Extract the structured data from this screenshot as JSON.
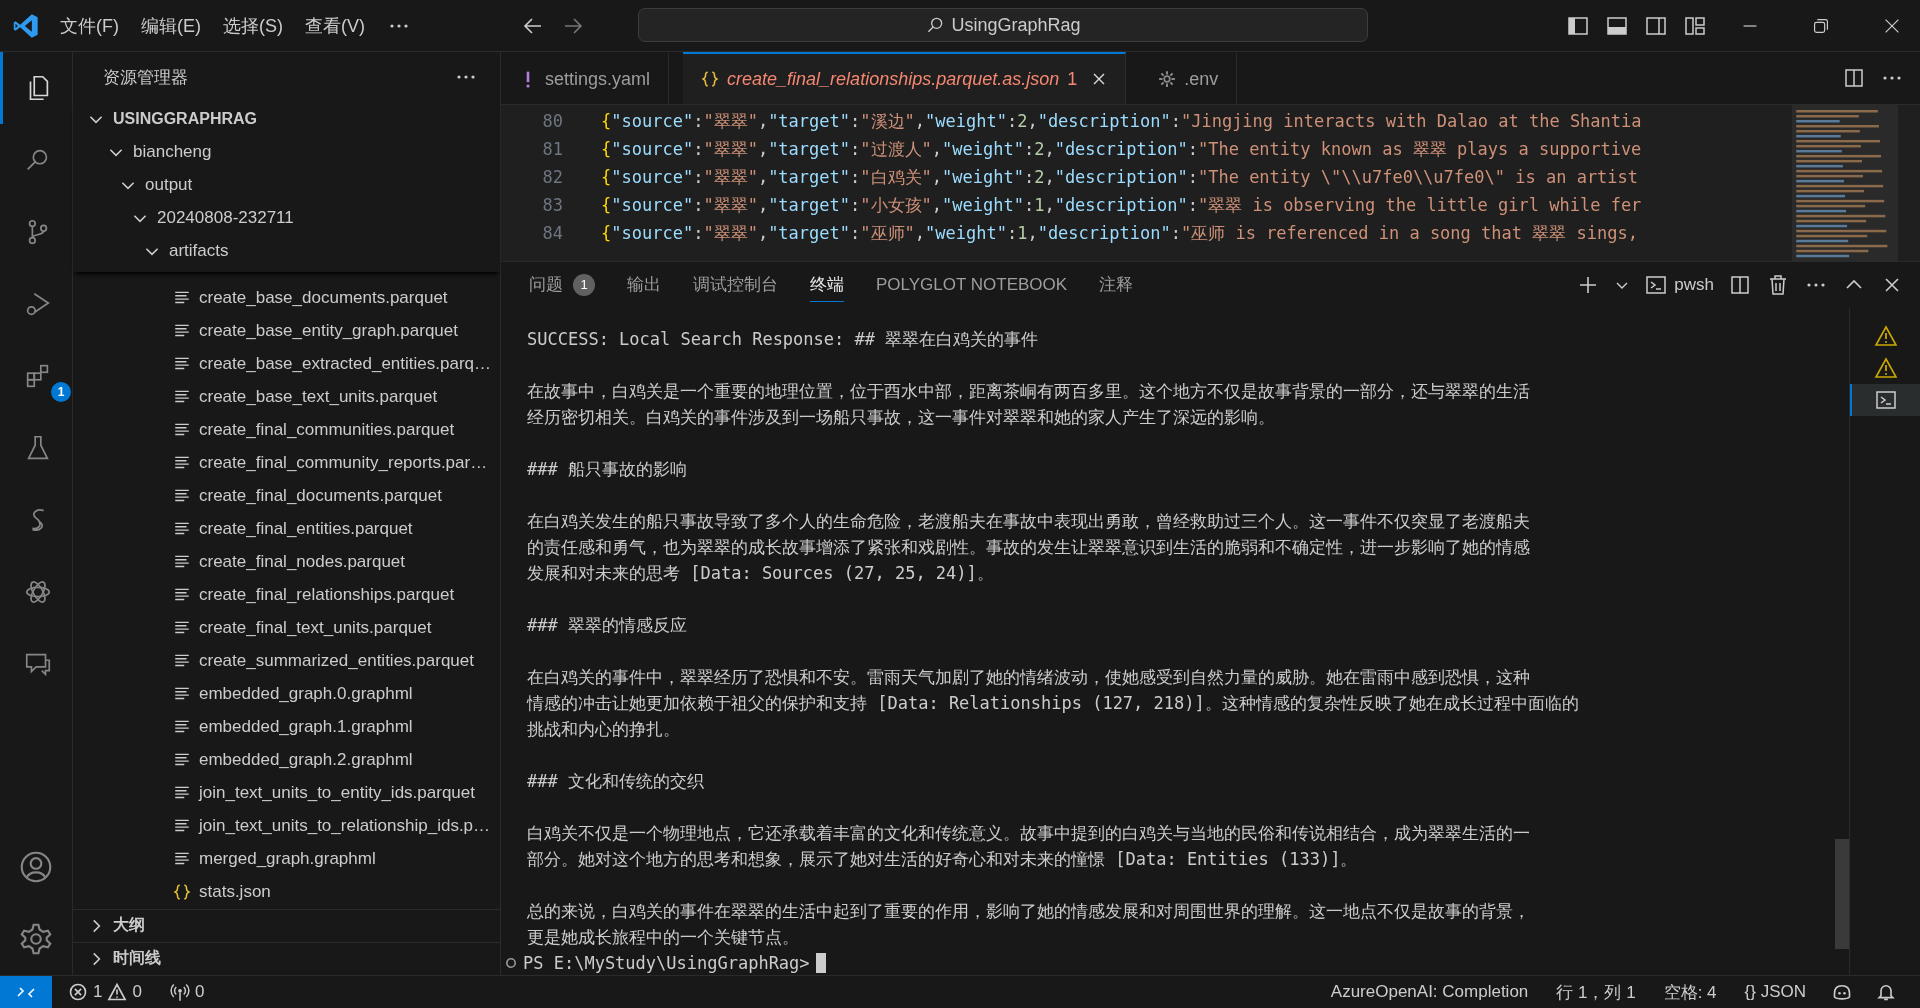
{
  "title_bar": {
    "menus": [
      "文件(F)",
      "编辑(E)",
      "选择(S)",
      "查看(V)"
    ],
    "search": "UsingGraphRag"
  },
  "activity_bar": [
    {
      "kind": "explorer",
      "selected": true
    },
    {
      "kind": "search",
      "selected": false
    },
    {
      "kind": "source-control",
      "selected": false
    },
    {
      "kind": "run-debug",
      "selected": false
    },
    {
      "kind": "extensions",
      "selected": false,
      "badge": "1"
    },
    {
      "kind": "testing",
      "selected": false
    },
    {
      "kind": "swirl",
      "selected": false
    },
    {
      "kind": "atom",
      "selected": false
    },
    {
      "kind": "chat",
      "selected": false
    }
  ],
  "sidebar": {
    "title": "资源管理器",
    "tree": {
      "label": "USINGGRAPHRAG",
      "kind": "folder",
      "expanded": true,
      "children": [
        {
          "label": "biancheng",
          "kind": "folder",
          "expanded": true,
          "children": [
            {
              "label": "output",
              "kind": "folder",
              "expanded": true,
              "children": [
                {
                  "label": "20240808-232711",
                  "kind": "folder",
                  "expanded": true,
                  "children": [
                    {
                      "label": "artifacts",
                      "kind": "folder",
                      "expanded": true,
                      "children": [
                        {
                          "label": "create_base_documents.parquet",
                          "kind": "file"
                        },
                        {
                          "label": "create_base_entity_graph.parquet",
                          "kind": "file"
                        },
                        {
                          "label": "create_base_extracted_entities.parq…",
                          "kind": "file"
                        },
                        {
                          "label": "create_base_text_units.parquet",
                          "kind": "file"
                        },
                        {
                          "label": "create_final_communities.parquet",
                          "kind": "file"
                        },
                        {
                          "label": "create_final_community_reports.par…",
                          "kind": "file"
                        },
                        {
                          "label": "create_final_documents.parquet",
                          "kind": "file"
                        },
                        {
                          "label": "create_final_entities.parquet",
                          "kind": "file"
                        },
                        {
                          "label": "create_final_nodes.parquet",
                          "kind": "file"
                        },
                        {
                          "label": "create_final_relationships.parquet",
                          "kind": "file"
                        },
                        {
                          "label": "create_final_text_units.parquet",
                          "kind": "file"
                        },
                        {
                          "label": "create_summarized_entities.parquet",
                          "kind": "file"
                        },
                        {
                          "label": "embedded_graph.0.graphml",
                          "kind": "file"
                        },
                        {
                          "label": "embedded_graph.1.graphml",
                          "kind": "file"
                        },
                        {
                          "label": "embedded_graph.2.graphml",
                          "kind": "file"
                        },
                        {
                          "label": "join_text_units_to_entity_ids.parquet",
                          "kind": "file"
                        },
                        {
                          "label": "join_text_units_to_relationship_ids.p…",
                          "kind": "file"
                        },
                        {
                          "label": "merged_graph.graphml",
                          "kind": "file"
                        },
                        {
                          "label": "stats.json",
                          "kind": "json"
                        }
                      ]
                    }
                  ]
                }
              ]
            }
          ]
        }
      ]
    },
    "sections": [
      {
        "label": "大纲",
        "expanded": false
      },
      {
        "label": "时间线",
        "expanded": false
      }
    ]
  },
  "editor": {
    "tabs": [
      {
        "kind": "yaml",
        "label": "settings.yaml",
        "selected": false
      },
      {
        "kind": "json",
        "label": "create_final_relationships.parquet.as.json",
        "problems": "1",
        "selected": true
      },
      {
        "kind": "env",
        "label": ".env",
        "selected": false
      }
    ],
    "lines": [
      {
        "number": "80",
        "tokens": [
          {
            "kind": "brace",
            "text": "{"
          },
          {
            "kind": "key",
            "text": "\"source\""
          },
          {
            "kind": "punct",
            "text": ":"
          },
          {
            "kind": "str",
            "text": "\"翠翠\""
          },
          {
            "kind": "punct",
            "text": ","
          },
          {
            "kind": "key",
            "text": "\"target\""
          },
          {
            "kind": "punct",
            "text": ":"
          },
          {
            "kind": "str",
            "text": "\"溪边\""
          },
          {
            "kind": "punct",
            "text": ","
          },
          {
            "kind": "key",
            "text": "\"weight\""
          },
          {
            "kind": "punct",
            "text": ":"
          },
          {
            "kind": "num",
            "text": "2"
          },
          {
            "kind": "punct",
            "text": ","
          },
          {
            "kind": "key",
            "text": "\"description\""
          },
          {
            "kind": "punct",
            "text": ":"
          },
          {
            "kind": "str",
            "text": "\"Jingjing interacts with Dalao at the Shantia"
          }
        ]
      },
      {
        "number": "81",
        "tokens": [
          {
            "kind": "brace",
            "text": "{"
          },
          {
            "kind": "key",
            "text": "\"source\""
          },
          {
            "kind": "punct",
            "text": ":"
          },
          {
            "kind": "str",
            "text": "\"翠翠\""
          },
          {
            "kind": "punct",
            "text": ","
          },
          {
            "kind": "key",
            "text": "\"target\""
          },
          {
            "kind": "punct",
            "text": ":"
          },
          {
            "kind": "str",
            "text": "\"过渡人\""
          },
          {
            "kind": "punct",
            "text": ","
          },
          {
            "kind": "key",
            "text": "\"weight\""
          },
          {
            "kind": "punct",
            "text": ":"
          },
          {
            "kind": "num",
            "text": "2"
          },
          {
            "kind": "punct",
            "text": ","
          },
          {
            "kind": "key",
            "text": "\"description\""
          },
          {
            "kind": "punct",
            "text": ":"
          },
          {
            "kind": "str",
            "text": "\"The entity known as 翠翠 plays a supportive"
          }
        ]
      },
      {
        "number": "82",
        "tokens": [
          {
            "kind": "brace",
            "text": "{"
          },
          {
            "kind": "key",
            "text": "\"source\""
          },
          {
            "kind": "punct",
            "text": ":"
          },
          {
            "kind": "str",
            "text": "\"翠翠\""
          },
          {
            "kind": "punct",
            "text": ","
          },
          {
            "kind": "key",
            "text": "\"target\""
          },
          {
            "kind": "punct",
            "text": ":"
          },
          {
            "kind": "str",
            "text": "\"白鸡关\""
          },
          {
            "kind": "punct",
            "text": ","
          },
          {
            "kind": "key",
            "text": "\"weight\""
          },
          {
            "kind": "punct",
            "text": ":"
          },
          {
            "kind": "num",
            "text": "2"
          },
          {
            "kind": "punct",
            "text": ","
          },
          {
            "kind": "key",
            "text": "\"description\""
          },
          {
            "kind": "punct",
            "text": ":"
          },
          {
            "kind": "str",
            "text": "\"The entity \\\"\\\\u7fe0\\\\u7fe0\\\" is an artist"
          }
        ]
      },
      {
        "number": "83",
        "tokens": [
          {
            "kind": "brace",
            "text": "{"
          },
          {
            "kind": "key",
            "text": "\"source\""
          },
          {
            "kind": "punct",
            "text": ":"
          },
          {
            "kind": "str",
            "text": "\"翠翠\""
          },
          {
            "kind": "punct",
            "text": ","
          },
          {
            "kind": "key",
            "text": "\"target\""
          },
          {
            "kind": "punct",
            "text": ":"
          },
          {
            "kind": "str",
            "text": "\"小女孩\""
          },
          {
            "kind": "punct",
            "text": ","
          },
          {
            "kind": "key",
            "text": "\"weight\""
          },
          {
            "kind": "punct",
            "text": ":"
          },
          {
            "kind": "num",
            "text": "1"
          },
          {
            "kind": "punct",
            "text": ","
          },
          {
            "kind": "key",
            "text": "\"description\""
          },
          {
            "kind": "punct",
            "text": ":"
          },
          {
            "kind": "str",
            "text": "\"翠翠 is observing the little girl while fer"
          }
        ]
      },
      {
        "number": "84",
        "tokens": [
          {
            "kind": "brace",
            "text": "{"
          },
          {
            "kind": "key",
            "text": "\"source\""
          },
          {
            "kind": "punct",
            "text": ":"
          },
          {
            "kind": "str",
            "text": "\"翠翠\""
          },
          {
            "kind": "punct",
            "text": ","
          },
          {
            "kind": "key",
            "text": "\"target\""
          },
          {
            "kind": "punct",
            "text": ":"
          },
          {
            "kind": "str",
            "text": "\"巫师\""
          },
          {
            "kind": "punct",
            "text": ","
          },
          {
            "kind": "key",
            "text": "\"weight\""
          },
          {
            "kind": "punct",
            "text": ":"
          },
          {
            "kind": "num",
            "text": "1"
          },
          {
            "kind": "punct",
            "text": ","
          },
          {
            "kind": "key",
            "text": "\"description\""
          },
          {
            "kind": "punct",
            "text": ":"
          },
          {
            "kind": "str",
            "text": "\"巫师 is referenced in a song that 翠翠 sings,"
          }
        ]
      }
    ]
  },
  "panel": {
    "tabs": [
      {
        "label": "问题",
        "badge": "1",
        "selected": false
      },
      {
        "label": "输出",
        "selected": false
      },
      {
        "label": "调试控制台",
        "selected": false
      },
      {
        "label": "终端",
        "selected": true
      },
      {
        "label": "POLYGLOT NOTEBOOK",
        "selected": false
      },
      {
        "label": "注释",
        "selected": false
      }
    ],
    "shell": "pwsh",
    "terminal": {
      "paragraphs": [
        [
          "SUCCESS: Local Search Response: ## 翠翠在白鸡关的事件"
        ],
        [
          "在故事中，白鸡关是一个重要的地理位置，位于酉水中部，距离茶峒有两百多里。这个地方不仅是故事背景的一部分，还与翠翠的生活",
          "经历密切相关。白鸡关的事件涉及到一场船只事故，这一事件对翠翠和她的家人产生了深远的影响。"
        ],
        [
          "### 船只事故的影响"
        ],
        [
          "在白鸡关发生的船只事故导致了多个人的生命危险，老渡船夫在事故中表现出勇敢，曾经救助过三个人。这一事件不仅突显了老渡船夫",
          "的责任感和勇气，也为翠翠的成长故事增添了紧张和戏剧性。事故的发生让翠翠意识到生活的脆弱和不确定性，进一步影响了她的情感",
          "发展和对未来的思考 [Data: Sources (27, 25, 24)]。"
        ],
        [
          "### 翠翠的情感反应"
        ],
        [
          "在白鸡关的事件中，翠翠经历了恐惧和不安。雷雨天气加剧了她的情绪波动，使她感受到自然力量的威胁。她在雷雨中感到恐惧，这种",
          "情感的冲击让她更加依赖于祖父的保护和支持 [Data: Relationships (127, 218)]。这种情感的复杂性反映了她在成长过程中面临的",
          "挑战和内心的挣扎。"
        ],
        [
          "### 文化和传统的交织"
        ],
        [
          "白鸡关不仅是一个物理地点，它还承载着丰富的文化和传统意义。故事中提到的白鸡关与当地的民俗和传说相结合，成为翠翠生活的一",
          "部分。她对这个地方的思考和想象，展示了她对生活的好奇心和对未来的憧憬 [Data: Entities (133)]。"
        ],
        [
          "总的来说，白鸡关的事件在翠翠的生活中起到了重要的作用，影响了她的情感发展和对周围世界的理解。这一地点不仅是故事的背景，",
          "更是她成长旅程中的一个关键节点。"
        ]
      ],
      "prompt": "PS E:\\MyStudy\\UsingGraphRag>"
    },
    "terminal_list": [
      {
        "kind": "warning",
        "selected": false
      },
      {
        "kind": "warning",
        "selected": false
      },
      {
        "kind": "terminal",
        "selected": true
      }
    ]
  },
  "status_bar": {
    "errors": "1",
    "warnings": "0",
    "ports": "0",
    "items": [
      "AzureOpenAI: Completion",
      "行 1，列 1",
      "空格: 4",
      "{} JSON"
    ]
  }
}
